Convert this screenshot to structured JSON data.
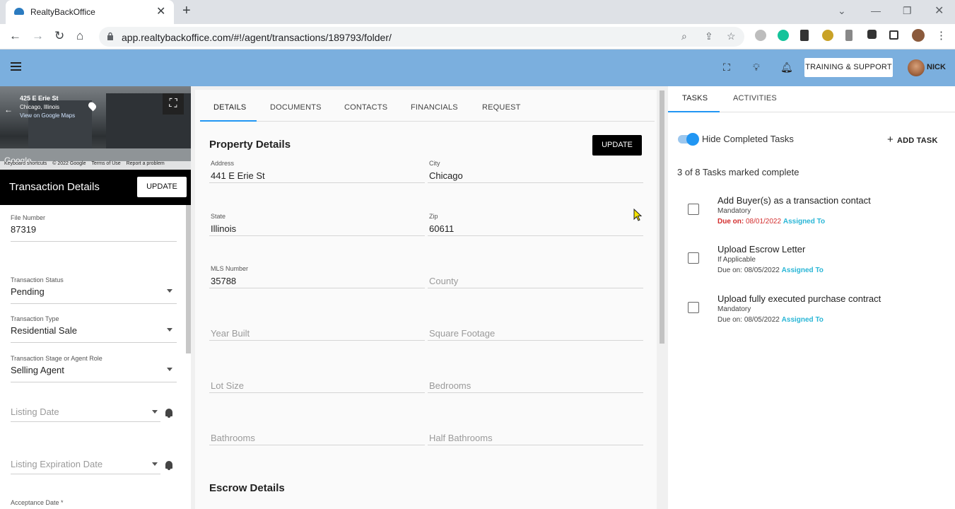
{
  "browser": {
    "tab_title": "RealtyBackOffice",
    "url": "app.realtybackoffice.com/#!/agent/transactions/189793/folder/"
  },
  "header": {
    "training_label": "TRAINING & SUPPORT",
    "user_name": "NICK"
  },
  "streetview": {
    "address": "425 E Erie St",
    "city": "Chicago, Illinois",
    "maps_link": "View on Google Maps",
    "google": "Google",
    "footer": [
      "Keyboard shortcuts",
      "© 2022 Google",
      "Terms of Use",
      "Report a problem"
    ]
  },
  "left": {
    "title": "Transaction Details",
    "update_label": "UPDATE",
    "file_number_label": "File Number",
    "file_number": "87319",
    "status_label": "Transaction Status",
    "status": "Pending",
    "type_label": "Transaction Type",
    "type": "Residential Sale",
    "stage_label": "Transaction Stage or Agent Role",
    "stage": "Selling Agent",
    "listing_date_ph": "Listing Date",
    "listing_exp_ph": "Listing Expiration Date",
    "acceptance_label": "Acceptance Date *"
  },
  "middle": {
    "tabs": [
      "DETAILS",
      "DOCUMENTS",
      "CONTACTS",
      "FINANCIALS",
      "REQUEST"
    ],
    "section_title": "Property Details",
    "update_label": "UPDATE",
    "address_label": "Address",
    "address": "441 E Erie St",
    "city_label": "City",
    "city": "Chicago",
    "state_label": "State",
    "state": "Illinois",
    "zip_label": "Zip",
    "zip": "60611",
    "mls_label": "MLS Number",
    "mls": "35788",
    "county_ph": "County",
    "year_built_ph": "Year Built",
    "sqft_ph": "Square Footage",
    "lot_size_ph": "Lot Size",
    "bedrooms_ph": "Bedrooms",
    "bathrooms_ph": "Bathrooms",
    "half_baths_ph": "Half Bathrooms",
    "escrow_title": "Escrow Details"
  },
  "right": {
    "tabs": [
      "TASKS",
      "ACTIVITIES"
    ],
    "hide_completed": "Hide Completed Tasks",
    "add_task": "ADD TASK",
    "summary": "3 of 8 Tasks marked complete",
    "due_prefix": "Due on:",
    "assigned": "Assigned To",
    "tasks": [
      {
        "title": "Add Buyer(s) as a transaction contact",
        "meta": "Mandatory",
        "due": "08/01/2022"
      },
      {
        "title": "Upload Escrow Letter",
        "meta": "If Applicable",
        "due": "08/05/2022"
      },
      {
        "title": "Upload fully executed purchase contract",
        "meta": "Mandatory",
        "due": "08/05/2022"
      }
    ]
  },
  "colors": {
    "header_bg": "#7bafde",
    "accent": "#2196f3",
    "overdue": "#d32f2f",
    "assigned": "#29b6d6"
  }
}
